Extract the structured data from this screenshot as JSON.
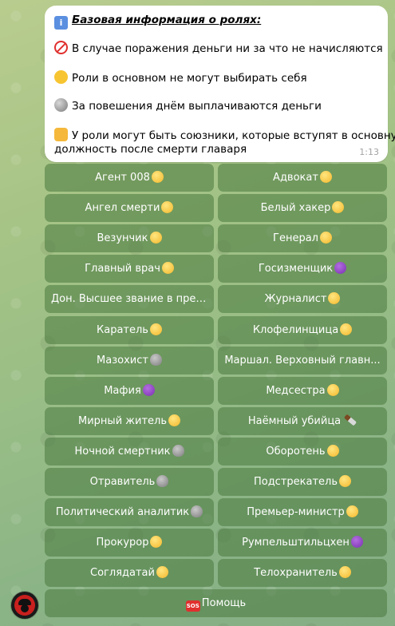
{
  "message": {
    "title": "Базовая информация о ролях:",
    "lines": [
      "В случае поражения деньги ни за что не начисляются",
      "Роли в основном не могут выбирать себя",
      "За повешения днём выплачиваются деньги",
      "У роли могут быть союзники, которые вступят в основную",
      "должность после смерти главаря"
    ],
    "icons": [
      "info-icon",
      "no-entry-icon",
      "thinking-face-icon",
      "moon-icon",
      "handshake-icon"
    ],
    "time": "1:13"
  },
  "keyboard": {
    "rows": [
      [
        "Агент 008",
        "Адвокат"
      ],
      [
        "Ангел смерти",
        "Белый хакер"
      ],
      [
        "Везунчик",
        "Генерал"
      ],
      [
        "Главный врач",
        "Госизменщик"
      ],
      [
        "Дон. Высшее звание в прес...",
        "Журналист"
      ],
      [
        "Каратель",
        "Клофелинщица"
      ],
      [
        "Мазохист",
        "Маршал. Верховный главн..."
      ],
      [
        "Мафия",
        "Медсестра"
      ],
      [
        "Мирный житель",
        "Наёмный убийца"
      ],
      [
        "Ночной смертник",
        "Оборотень"
      ],
      [
        "Отравитель",
        "Подстрекатель"
      ],
      [
        "Политический аналитик",
        "Премьер-министр"
      ],
      [
        "Прокурор",
        "Румпельштильцхен"
      ],
      [
        "Соглядатай",
        "Телохранитель"
      ]
    ],
    "row_icons": [
      [
        "smile",
        "smile"
      ],
      [
        "smile",
        "smile"
      ],
      [
        "smile",
        "smile"
      ],
      [
        "smile",
        "devil"
      ],
      [
        "none",
        "smile"
      ],
      [
        "smile",
        "smile"
      ],
      [
        "alien",
        "none"
      ],
      [
        "devil",
        "smile"
      ],
      [
        "smile",
        "knife"
      ],
      [
        "alien",
        "smile"
      ],
      [
        "alien",
        "smile"
      ],
      [
        "alien",
        "smile"
      ],
      [
        "smile",
        "devil"
      ],
      [
        "smile",
        "smile"
      ]
    ],
    "help_label": "Помощь",
    "help_icon": "sos-icon"
  },
  "colors": {
    "button_bg": "#48783e",
    "bubble_bg": "#ffffff",
    "time_color": "#a3a3a3"
  }
}
